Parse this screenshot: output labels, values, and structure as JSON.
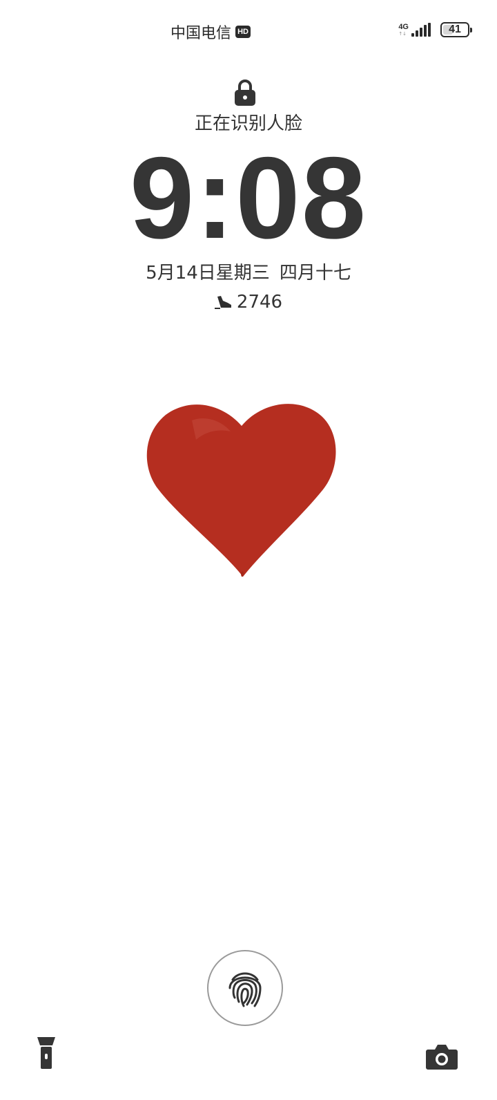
{
  "status_bar": {
    "carrier": "中国电信",
    "hd_badge": "HD",
    "network_type": "4G",
    "network_arrows": "↑↓",
    "signal_icon": "signal-bars-icon",
    "battery_percent": "41",
    "battery_level": 0.41
  },
  "lock_screen": {
    "lock_icon": "lock-icon",
    "face_status": "正在识别人脸",
    "time": "9:08",
    "date": "5月14日星期三",
    "lunar_date": "四月十七",
    "steps_icon": "shoe-icon",
    "steps": "2746",
    "wallpaper": "heart",
    "accent_color": "#b52e20"
  },
  "bottom_controls": {
    "fingerprint_icon": "fingerprint-icon",
    "flashlight_icon": "flashlight-icon",
    "camera_icon": "camera-icon"
  }
}
